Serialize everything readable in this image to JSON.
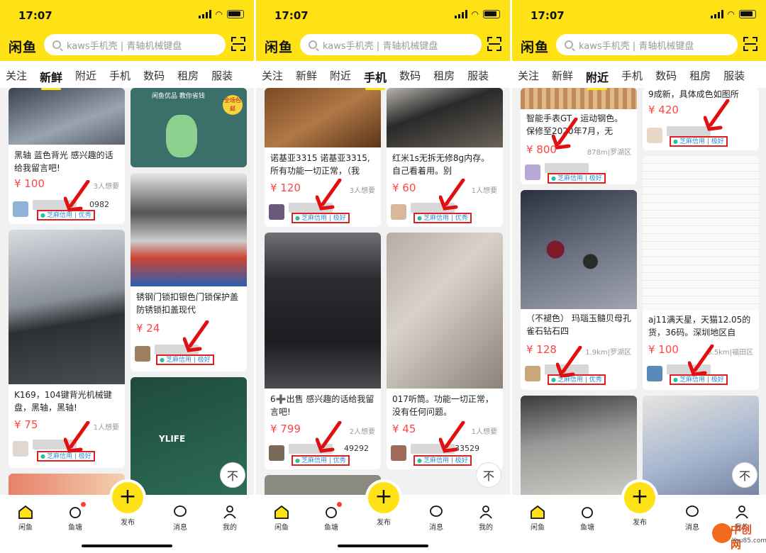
{
  "status": {
    "time": "17:07"
  },
  "app": {
    "logo": "闲鱼",
    "search_placeholder": "kaws手机壳 | 青轴机械键盘"
  },
  "tabs": [
    "关注",
    "新鲜",
    "附近",
    "手机",
    "数码",
    "租房",
    "服装"
  ],
  "nav": {
    "home": "闲鱼",
    "pond": "鱼塘",
    "publish": "发布",
    "msg": "消息",
    "me": "我的",
    "plus": "+"
  },
  "top_button": "不",
  "phones": [
    {
      "active_tab": "新鲜",
      "cards": [
        {
          "title": "黑轴 蓝色背光 感兴趣的话给我留言吧!",
          "price": "¥ 100",
          "want": "3人想要",
          "name": "0982",
          "badge": "芝麻信用 | 优秀"
        },
        {
          "title": "锈钢门锁扣银色门锁保护盖 防锈锁扣盖现代",
          "price": "¥ 24",
          "want": "",
          "name": "",
          "badge": "芝麻信用 | 极好"
        },
        {
          "title": "K169，104键背光机械键盘，黑轴，黑轴!",
          "price": "¥ 75",
          "want": "1人想要",
          "name": "",
          "badge": "芝麻信用 | 极好"
        },
        {
          "banner": "闲鱼优品 教你省钱",
          "tag": "全场包邮",
          "promo": "YLIFE"
        }
      ]
    },
    {
      "active_tab": "手机",
      "cards": [
        {
          "title": "诺基亚3315 诺基亚3315,所有功能一切正常，（我",
          "price": "¥ 120",
          "want": "3人想要",
          "name": "",
          "badge": "芝麻信用 | 极好"
        },
        {
          "title": "红米1s无拆无修8g内存。自己看着用。别",
          "price": "¥ 60",
          "want": "1人想要",
          "name": "",
          "badge": "芝麻信用 | 优秀"
        },
        {
          "title": "6➕出售 感兴趣的话给我留言吧!",
          "price": "¥ 799",
          "want": "2人想要",
          "name": "49292",
          "badge": "芝麻信用 | 优秀"
        },
        {
          "title": "017听筒。功能一切正常，没有任何问题。",
          "price": "¥ 45",
          "want": "1人想要",
          "name": "33529",
          "badge": "芝麻信用 | 极好"
        }
      ]
    },
    {
      "active_tab": "附近",
      "cards": [
        {
          "title": "智能手表GT，运动钢色。保修至2020年7月，无",
          "price": "¥ 800",
          "want": "878m|罗湖区",
          "name": "",
          "badge": "芝麻信用 | 极好"
        },
        {
          "title": "9成新，具体成色如图所",
          "price": "¥ 420",
          "want": "",
          "name": "",
          "badge": "芝麻信用 | 极好"
        },
        {
          "title": "（不褪色） 玛瑙玉髓贝母孔雀石钻石四",
          "price": "¥ 128",
          "want": "1.9km|罗湖区",
          "name": "",
          "badge": "芝麻信用 | 优秀"
        },
        {
          "title": "aj11满天星，天猫12.05的货，36码。深圳地区自",
          "price": "¥ 100",
          "want": "3.5km|福田区",
          "name": "",
          "badge": "芝麻信用 | 极好"
        }
      ]
    }
  ],
  "watermark": {
    "name": "中创网",
    "url": "You85.com"
  }
}
